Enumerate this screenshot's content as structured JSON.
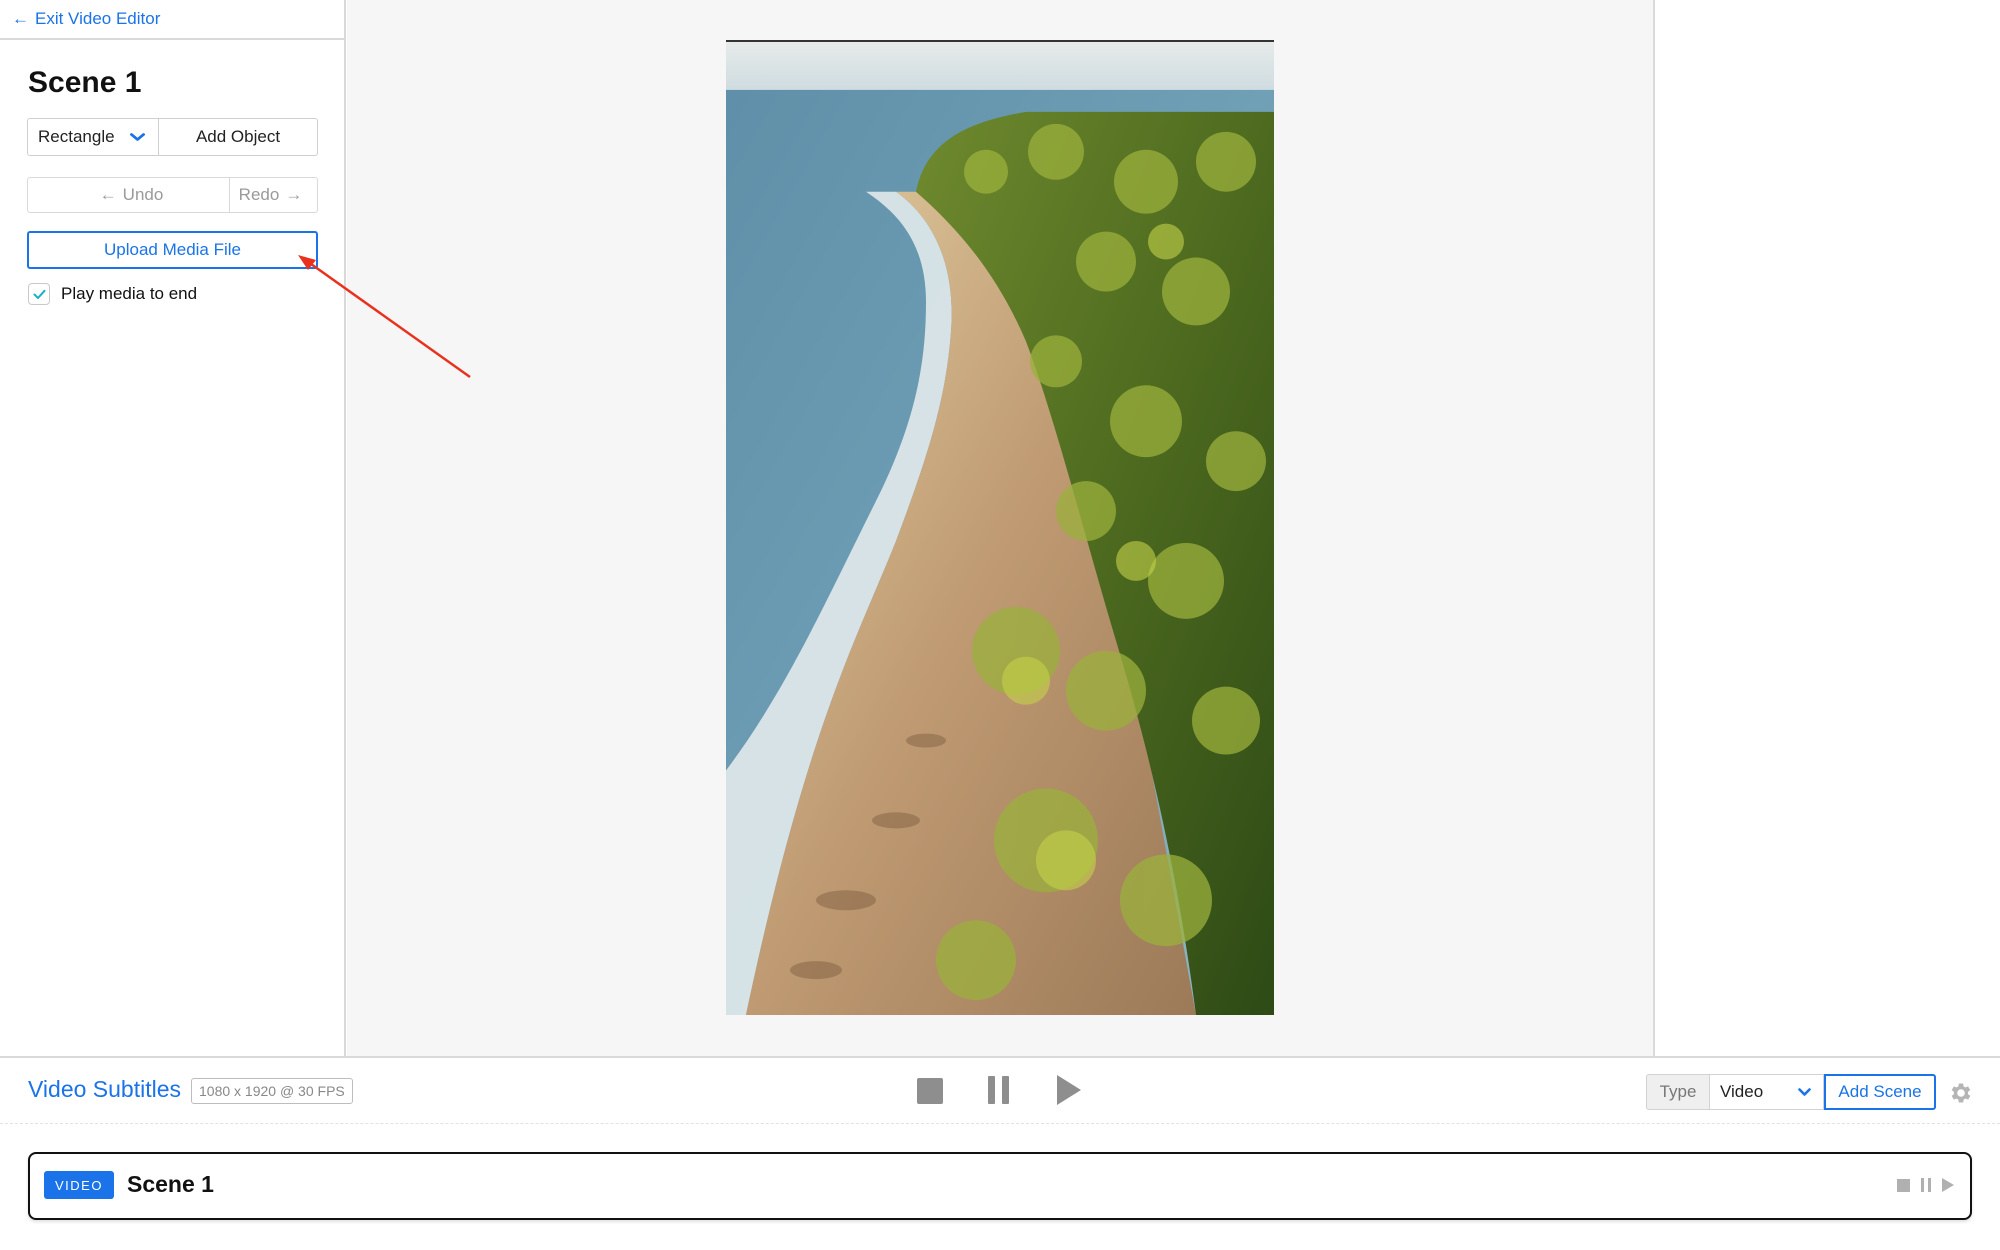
{
  "sidebar": {
    "exit_label": "Exit Video Editor",
    "scene_title": "Scene 1",
    "shape_select": "Rectangle",
    "add_object_label": "Add Object",
    "undo_label": "Undo",
    "redo_label": "Redo",
    "upload_label": "Upload Media File",
    "play_to_end_label": "Play media to end",
    "play_to_end_checked": true
  },
  "toolbar": {
    "project_name": "Video Subtitles",
    "spec": "1080 x 1920 @ 30 FPS",
    "type_label": "Type",
    "type_value": "Video",
    "add_scene_label": "Add Scene"
  },
  "timeline": {
    "scene": {
      "type_badge": "VIDEO",
      "title": "Scene 1"
    }
  },
  "colors": {
    "accent": "#1a73e8",
    "annotation_arrow": "#e8321e"
  },
  "icons": {
    "exit": "arrow-left-icon",
    "dropdown": "chevron-down-icon",
    "undo": "arrow-left-icon",
    "redo": "arrow-right-icon",
    "checkbox": "check-icon",
    "stop": "stop-icon",
    "pause": "pause-icon",
    "play": "play-icon",
    "settings": "gear-icon"
  }
}
